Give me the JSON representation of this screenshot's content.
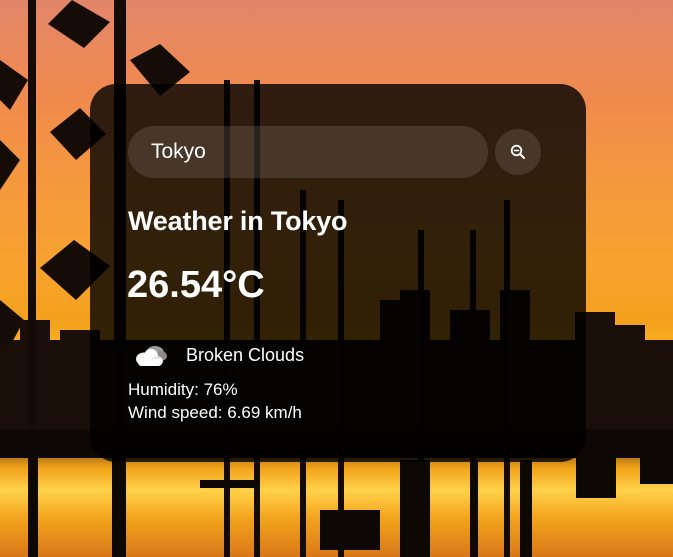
{
  "search": {
    "value": "Tokyo",
    "icon": "search-icon"
  },
  "weather": {
    "title": "Weather in Tokyo",
    "temperature": "26.54°C",
    "description": "Broken Clouds",
    "description_icon": "cloud-icon",
    "humidity": "Humidity: 76%",
    "wind": "Wind speed: 6.69 km/h"
  },
  "colors": {
    "card_background": "#000000cc",
    "text": "#ffffff",
    "sky_top": "#e2866a",
    "sky_horizon": "#fbb41c"
  }
}
